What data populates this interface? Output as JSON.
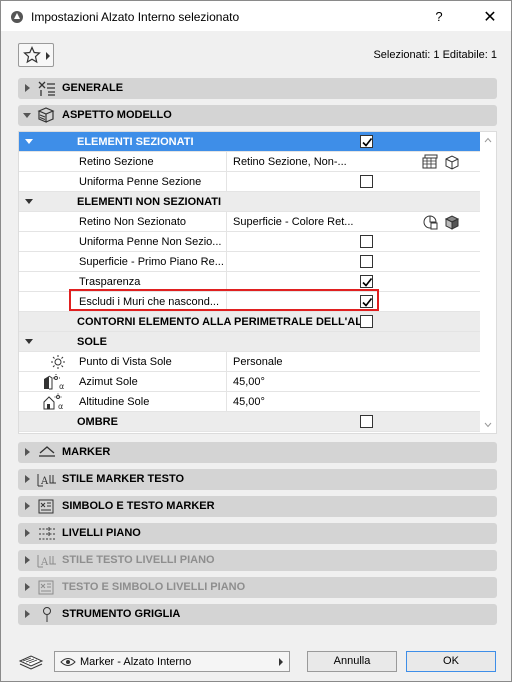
{
  "window": {
    "title": "Impostazioni Alzato Interno selezionato",
    "help_label": "?",
    "close_label": "✕"
  },
  "toolbar": {
    "selection_info": "Selezionati: 1 Editabile: 1"
  },
  "panels_top": [
    {
      "label": "GENERALE",
      "icon": "general-settings-icon",
      "expanded": false
    },
    {
      "label": "ASPETTO MODELLO",
      "icon": "model-appearance-icon",
      "expanded": true
    }
  ],
  "tree": {
    "rows": [
      {
        "type": "group",
        "label": "ELEMENTI SEZIONATI",
        "checked": true,
        "selected": true
      },
      {
        "type": "item",
        "label": "Retino Sezione",
        "value": "Retino Sezione, Non-...",
        "icons": [
          "fill-pattern-icon",
          "cube-outline-icon"
        ]
      },
      {
        "type": "item",
        "label": "Uniforma Penne Sezione",
        "checked": false
      },
      {
        "type": "group",
        "label": "ELEMENTI NON SEZIONATI"
      },
      {
        "type": "item",
        "label": "Retino Non Sezionato",
        "value": "Superficie - Colore Ret...",
        "icons": [
          "surface-fill-icon",
          "cube-solid-icon"
        ]
      },
      {
        "type": "item",
        "label": "Uniforma Penne Non Sezio...",
        "checked": false
      },
      {
        "type": "item",
        "label": "Superficie - Primo Piano Re...",
        "checked": false
      },
      {
        "type": "item",
        "label": "Trasparenza",
        "checked": true
      },
      {
        "type": "item",
        "label": "Escludi i Muri che nascond...",
        "checked": true
      },
      {
        "type": "group",
        "label": "CONTORNI ELEMENTO ALLA PERIMETRALE DELL'AL...",
        "checked": false
      },
      {
        "type": "group",
        "label": "SOLE",
        "expanded": true
      },
      {
        "type": "item",
        "label": "Punto di Vista Sole",
        "value": "Personale",
        "left_icon": "sun-icon"
      },
      {
        "type": "item",
        "label": "Azimut Sole",
        "value": "45,00°",
        "left_icon": "sun-azimuth-icon"
      },
      {
        "type": "item",
        "label": "Altitudine Sole",
        "value": "45,00°",
        "left_icon": "sun-altitude-icon"
      },
      {
        "type": "group",
        "label": "OMBRE",
        "checked": false
      }
    ]
  },
  "panels_bottom": [
    {
      "label": "MARKER",
      "icon": "marker-icon",
      "disabled": false
    },
    {
      "label": "STILE MARKER TESTO",
      "icon": "marker-text-style-icon",
      "disabled": false
    },
    {
      "label": "SIMBOLO E TESTO MARKER",
      "icon": "marker-symbol-text-icon",
      "disabled": false
    },
    {
      "label": "LIVELLI PIANO",
      "icon": "story-levels-icon",
      "disabled": false
    },
    {
      "label": "STILE TESTO LIVELLI PIANO",
      "icon": "story-text-style-icon",
      "disabled": true
    },
    {
      "label": "TESTO E SIMBOLO LIVELLI PIANO",
      "icon": "story-symbol-text-icon",
      "disabled": true
    },
    {
      "label": "STRUMENTO GRIGLIA",
      "icon": "grid-tool-icon",
      "disabled": false
    }
  ],
  "footer": {
    "marker_select": "Marker - Alzato Interno",
    "cancel_label": "Annulla",
    "ok_label": "OK"
  },
  "colors": {
    "selected_row": "#3e8ee8",
    "highlight_border": "#e02020",
    "panel_header": "#d4d4d4"
  }
}
